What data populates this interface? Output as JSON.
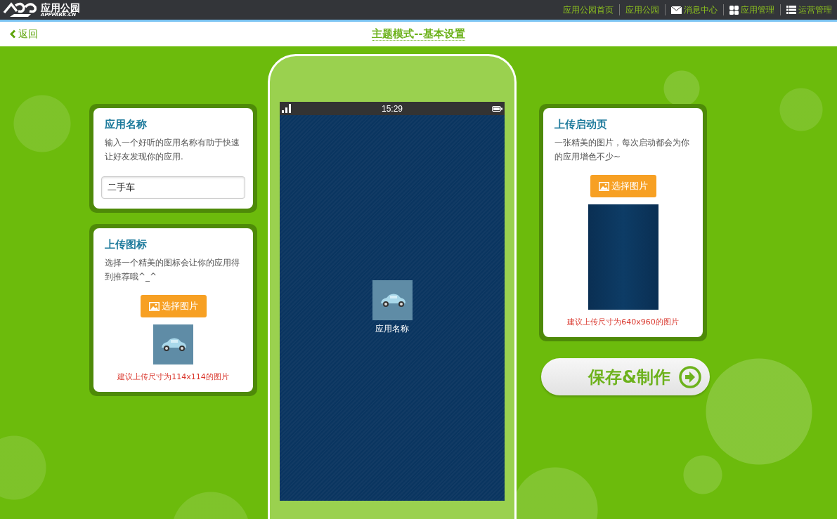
{
  "topbar": {
    "logo_text": "应用公园",
    "logo_subtext": "APPPARK.CN",
    "nav": [
      {
        "label": "应用公园首页",
        "kind": "plain"
      },
      {
        "label": "应用公园",
        "kind": "plain"
      },
      {
        "label": "消息中心",
        "kind": "mail"
      },
      {
        "label": "应用管理",
        "kind": "grid"
      },
      {
        "label": "运营管理",
        "kind": "list"
      }
    ]
  },
  "header": {
    "back": "返回",
    "title": "主题模式--基本设置"
  },
  "app_name_card": {
    "title": "应用名称",
    "description": "输入一个好听的应用名称有助于快速让好友发现你的应用.",
    "value": "二手车"
  },
  "icon_card": {
    "title": "上传图标",
    "description": "选择一个精美的图标会让你的应用得到推荐哦^_^",
    "button": "选择图片",
    "hint": "建议上传尺寸为114x114的图片"
  },
  "phone": {
    "time": "15:29",
    "app_label": "应用名称"
  },
  "splash_card": {
    "title": "上传启动页",
    "description": "一张精美的图片，每次启动都会为你的应用增色不少~",
    "button": "选择图片",
    "hint": "建议上传尺寸为640x960的图片"
  },
  "save_button": "保存&制作"
}
